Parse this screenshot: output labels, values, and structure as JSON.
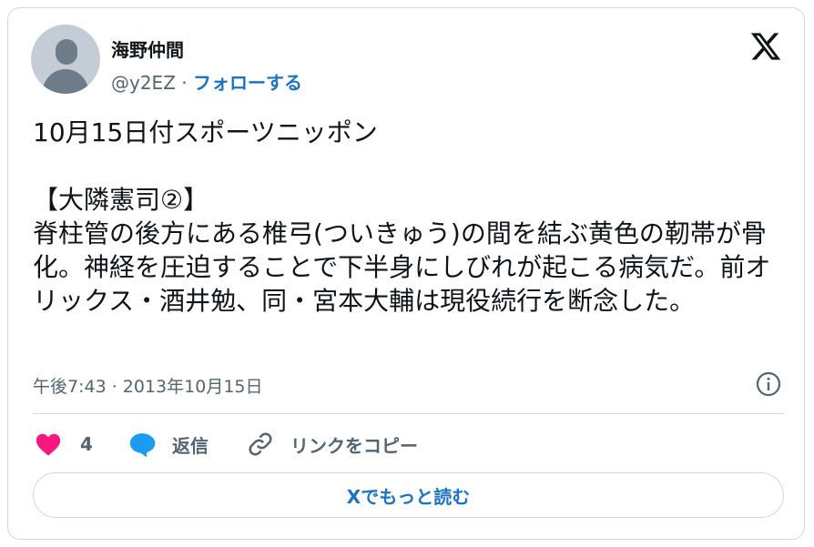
{
  "author": {
    "display_name": "海野仲間",
    "handle": "@y2EZ",
    "separator": "·",
    "follow_label": "フォローする"
  },
  "tweet": {
    "text": "10月15日付スポーツニッポン\n\n【大隣憲司②】\n脊柱管の後方にある椎弓(ついきゅう)の間を結ぶ黄色の靭帯が骨化。神経を圧迫することで下半身にしびれが起こる病気だ。前オリックス・酒井勉、同・宮本大輔は現役続行を断念した。",
    "timestamp": "午後7:43 · 2013年10月15日"
  },
  "actions": {
    "like_count": "4",
    "reply_label": "返信",
    "copy_link_label": "リンクをコピー"
  },
  "read_more_label": "Xでもっと読む",
  "icons": {
    "logo": "x-logo-icon",
    "info": "info-icon",
    "like": "heart-icon",
    "reply": "speech-bubble-icon",
    "copy": "link-icon"
  },
  "colors": {
    "accent": "#1a73c4",
    "like": "#f91880",
    "reply": "#1d9bf0",
    "muted": "#536471",
    "border": "#cfd9de"
  }
}
